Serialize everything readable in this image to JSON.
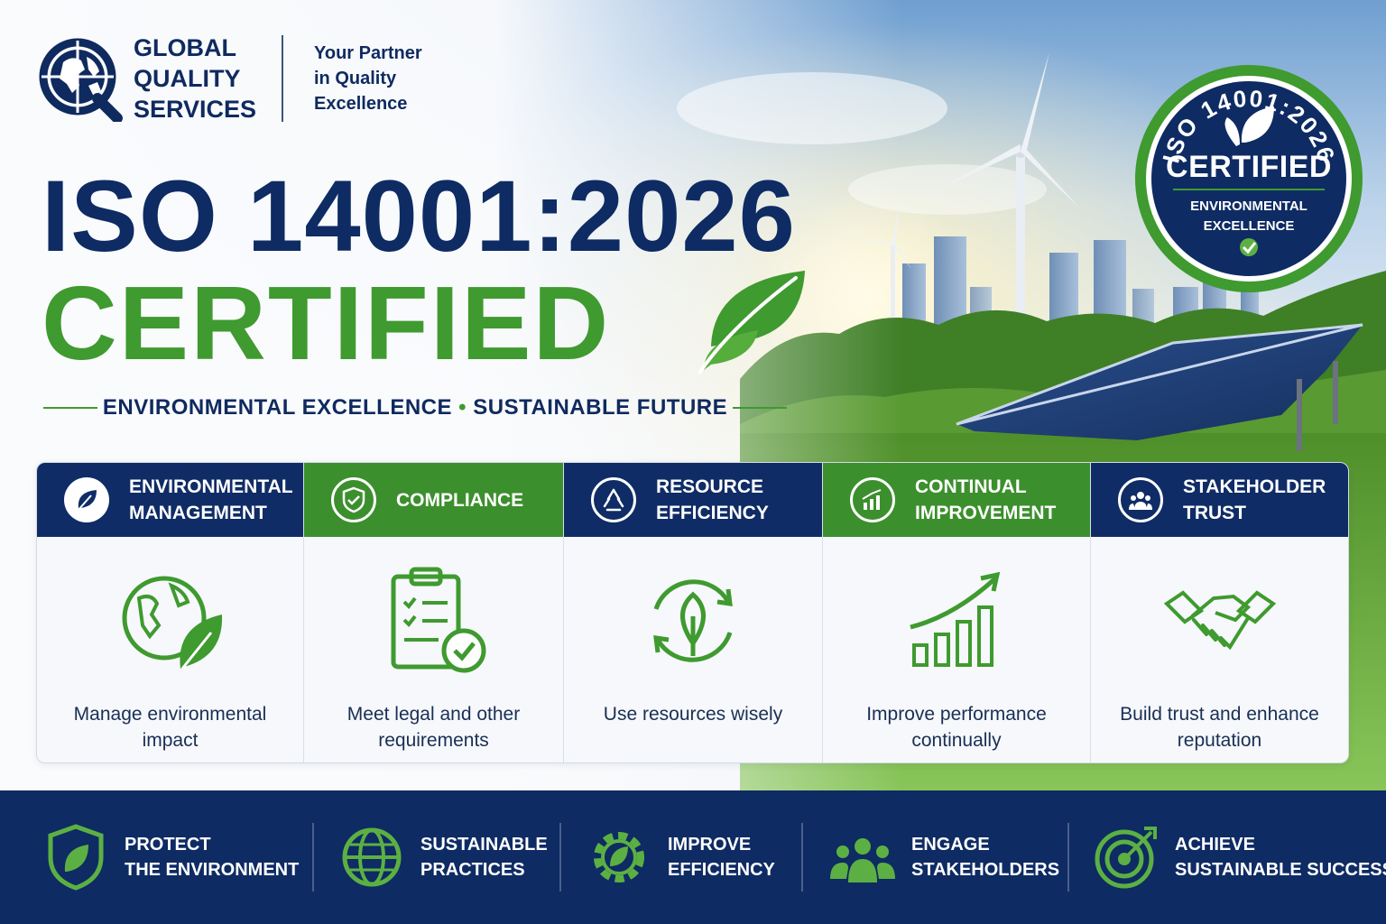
{
  "brand": {
    "name_lines": [
      "GLOBAL",
      "QUALITY",
      "SERVICES"
    ],
    "tagline_lines": [
      "Your Partner",
      "in Quality",
      "Excellence"
    ],
    "logo_icon": "globe-q-logo-icon"
  },
  "headline": {
    "line1": "ISO 14001:2026",
    "line2": "CERTIFIED",
    "subline_left": "ENVIRONMENTAL EXCELLENCE",
    "subline_sep": "•",
    "subline_right": "SUSTAINABLE FUTURE"
  },
  "badge": {
    "arc_text": "ISO 14001:2026",
    "title": "CERTIFIED",
    "sub_lines": [
      "ENVIRONMENTAL",
      "EXCELLENCE"
    ],
    "icon": "leaf-icon"
  },
  "features": [
    {
      "title": "ENVIRONMENTAL MANAGEMENT",
      "desc": "Manage environmental impact",
      "head_icon": "leaf-icon",
      "body_icon": "globe-leaf-icon",
      "style": "navy"
    },
    {
      "title": "COMPLIANCE",
      "desc": "Meet legal and other requirements",
      "head_icon": "shield-check-icon",
      "body_icon": "clipboard-check-icon",
      "style": "green"
    },
    {
      "title": "RESOURCE EFFICIENCY",
      "desc": "Use resources wisely",
      "head_icon": "recycle-icon",
      "body_icon": "cycle-leaf-icon",
      "style": "navy"
    },
    {
      "title": "CONTINUAL IMPROVEMENT",
      "desc": "Improve performance continually",
      "head_icon": "growth-chart-icon",
      "body_icon": "bar-chart-arrow-icon",
      "style": "green"
    },
    {
      "title": "STAKEHOLDER TRUST",
      "desc": "Build trust and enhance reputation",
      "head_icon": "people-icon",
      "body_icon": "handshake-icon",
      "style": "navy"
    }
  ],
  "bottom_items": [
    {
      "lines": [
        "PROTECT",
        "THE ENVIRONMENT"
      ],
      "icon": "shield-leaf-icon"
    },
    {
      "lines": [
        "SUSTAINABLE",
        "PRACTICES"
      ],
      "icon": "globe-icon"
    },
    {
      "lines": [
        "IMPROVE",
        "EFFICIENCY"
      ],
      "icon": "gear-leaf-icon"
    },
    {
      "lines": [
        "ENGAGE",
        "STAKEHOLDERS"
      ],
      "icon": "group-icon"
    },
    {
      "lines": [
        "ACHIEVE",
        "SUSTAINABLE SUCCESS"
      ],
      "icon": "target-icon"
    }
  ],
  "colors": {
    "navy": "#0e2b63",
    "green": "#3f9a2f",
    "light_green": "#5cb043"
  }
}
